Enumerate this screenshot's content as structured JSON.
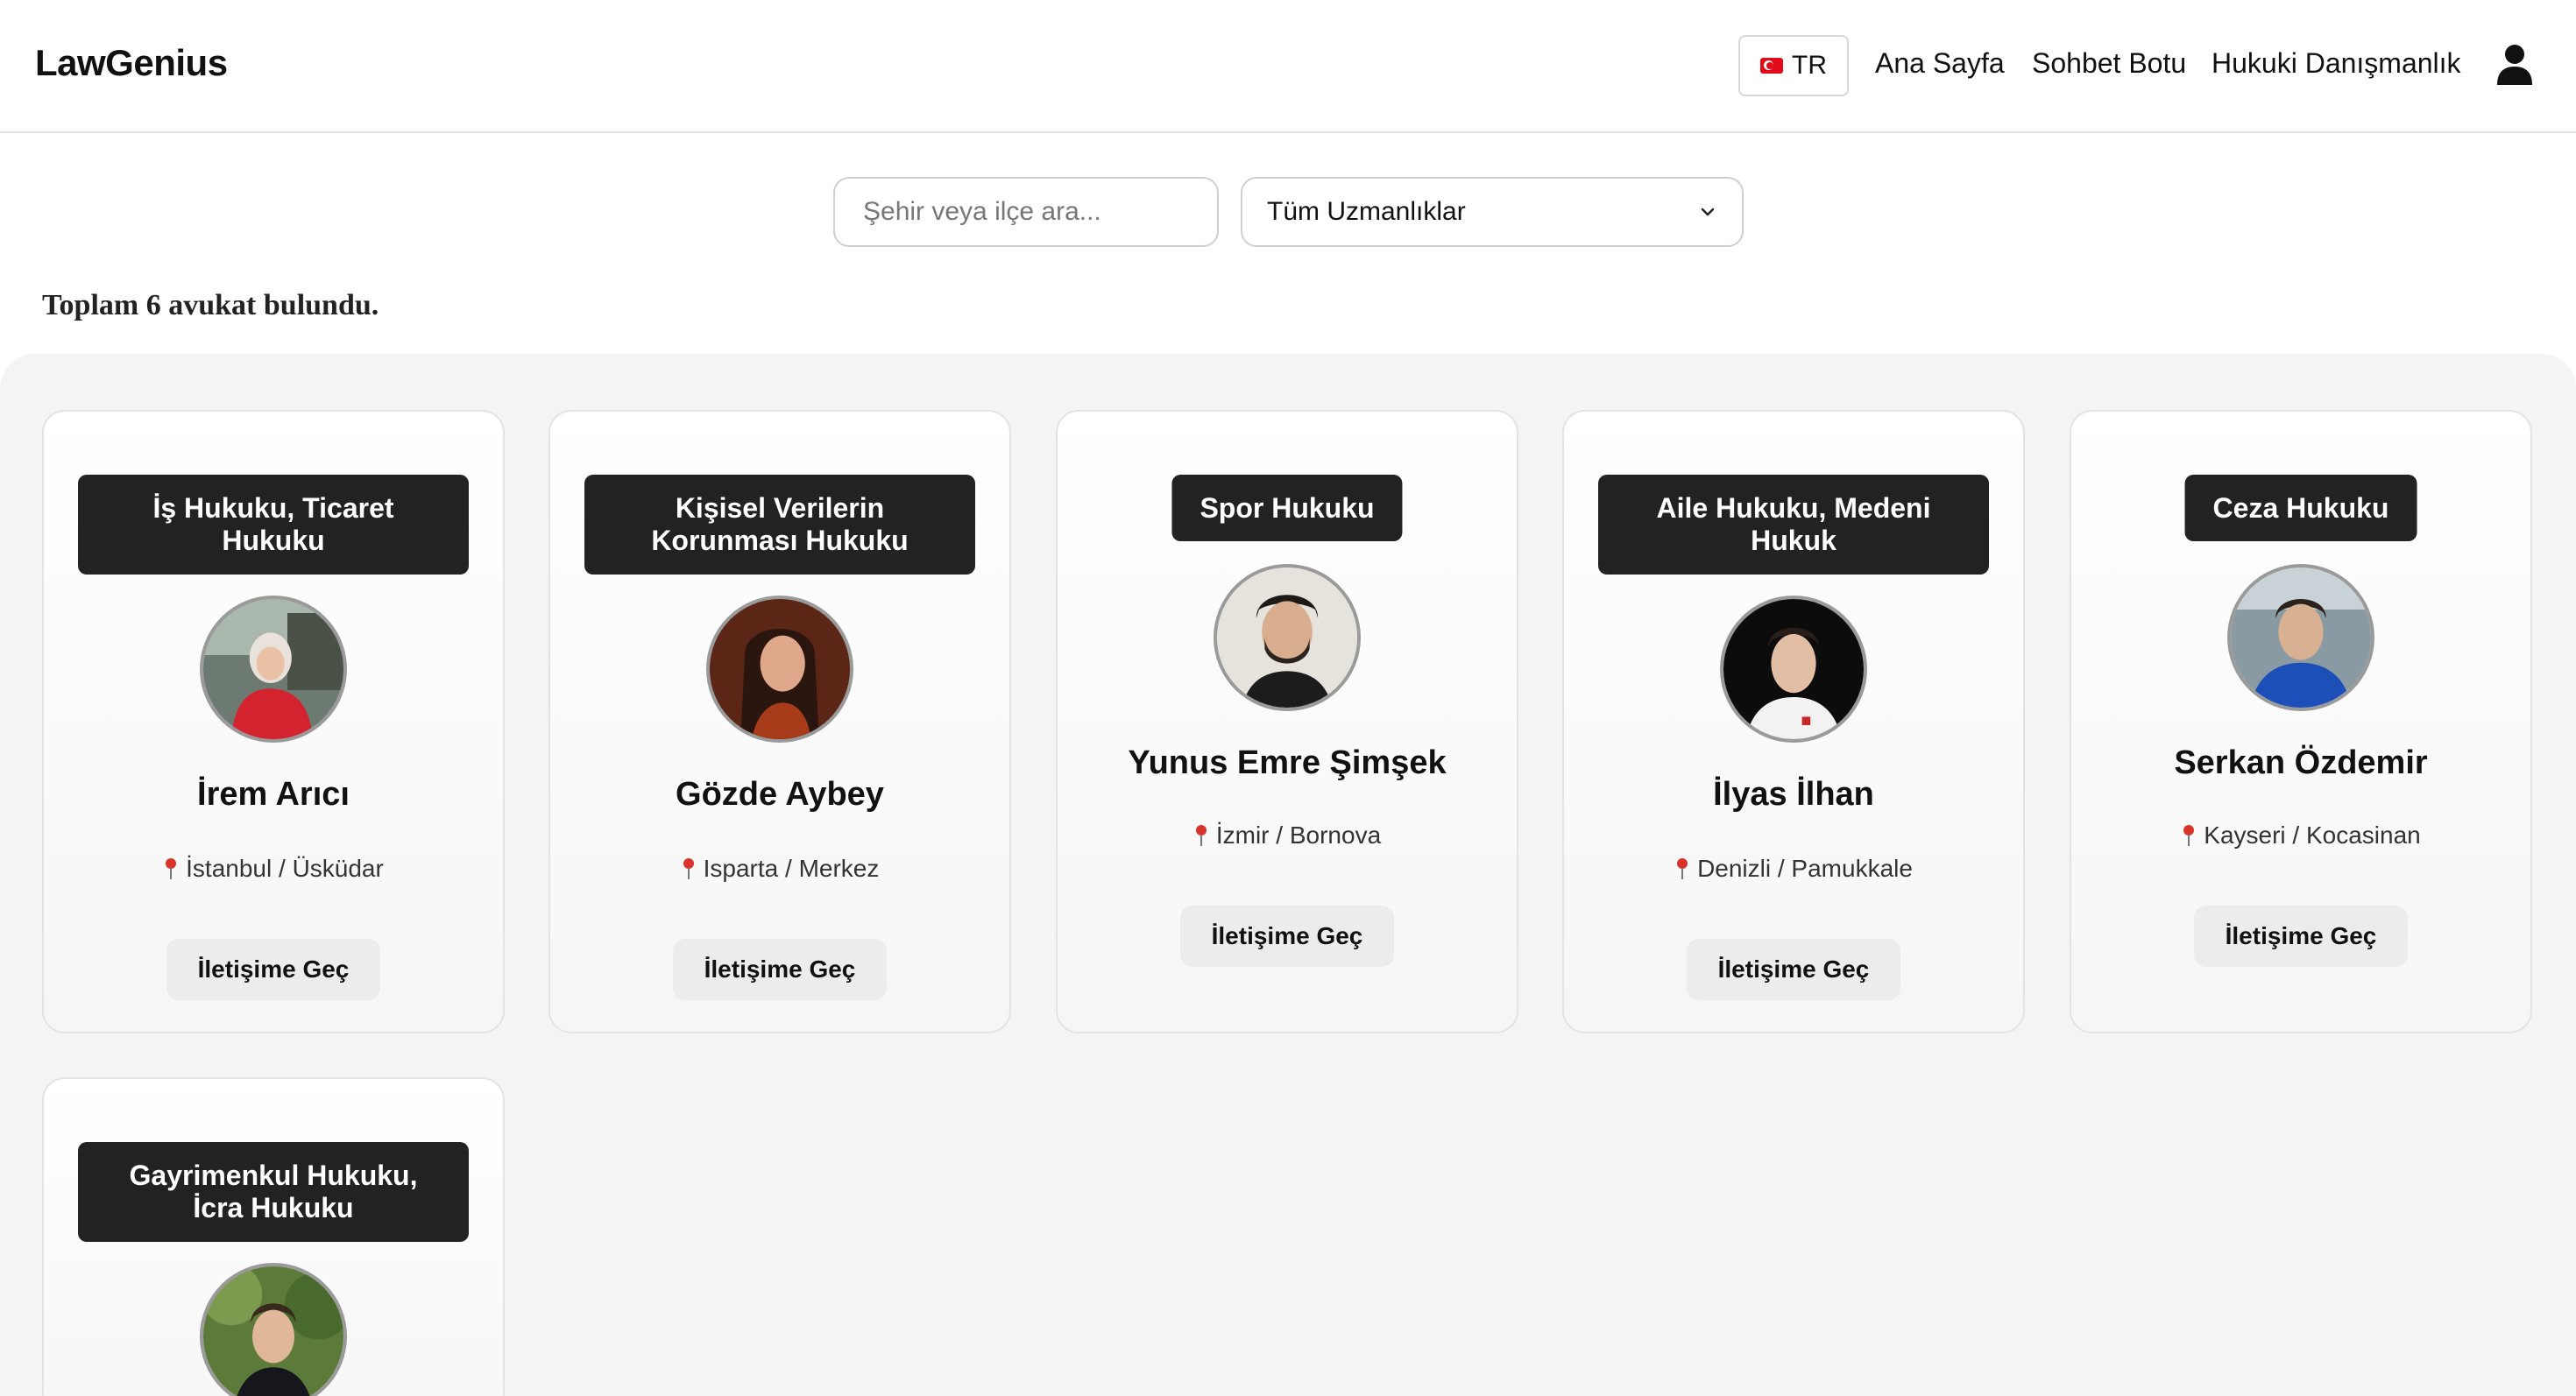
{
  "nav": {
    "brand": "LawGenius",
    "lang_label": "TR",
    "links": [
      "Ana Sayfa",
      "Sohbet Botu",
      "Hukuki Danışmanlık"
    ],
    "user_icon": "user-icon"
  },
  "filters": {
    "search_placeholder": "Şehir veya ilçe ara...",
    "specialty_selected": "Tüm Uzmanlıklar"
  },
  "results": {
    "summary": "Toplam 6 avukat bulundu."
  },
  "lawyers": [
    {
      "specialty": "İş Hukuku, Ticaret Hukuku",
      "name": "İrem Arıcı",
      "location": "İstanbul / Üsküdar",
      "contact_label": "İletişime Geç"
    },
    {
      "specialty": "Kişisel Verilerin Korunması Hukuku",
      "name": "Gözde Aybey",
      "location": "Isparta / Merkez",
      "contact_label": "İletişime Geç"
    },
    {
      "specialty": "Spor Hukuku",
      "name": "Yunus Emre Şimşek",
      "location": "İzmir / Bornova",
      "contact_label": "İletişime Geç"
    },
    {
      "specialty": "Aile Hukuku, Medeni Hukuk",
      "name": "İlyas İlhan",
      "location": "Denizli / Pamukkale",
      "contact_label": "İletişime Geç"
    },
    {
      "specialty": "Ceza Hukuku",
      "name": "Serkan Özdemir",
      "location": "Kayseri / Kocasinan",
      "contact_label": "İletişime Geç"
    },
    {
      "specialty": "Gayrimenkul Hukuku, İcra Hukuku",
      "name": "",
      "location": "",
      "contact_label": ""
    }
  ],
  "colors": {
    "badge_bg": "#222222",
    "pin": "#d9342b",
    "button_bg": "#ececec",
    "grid_bg": "#f4f4f4"
  }
}
